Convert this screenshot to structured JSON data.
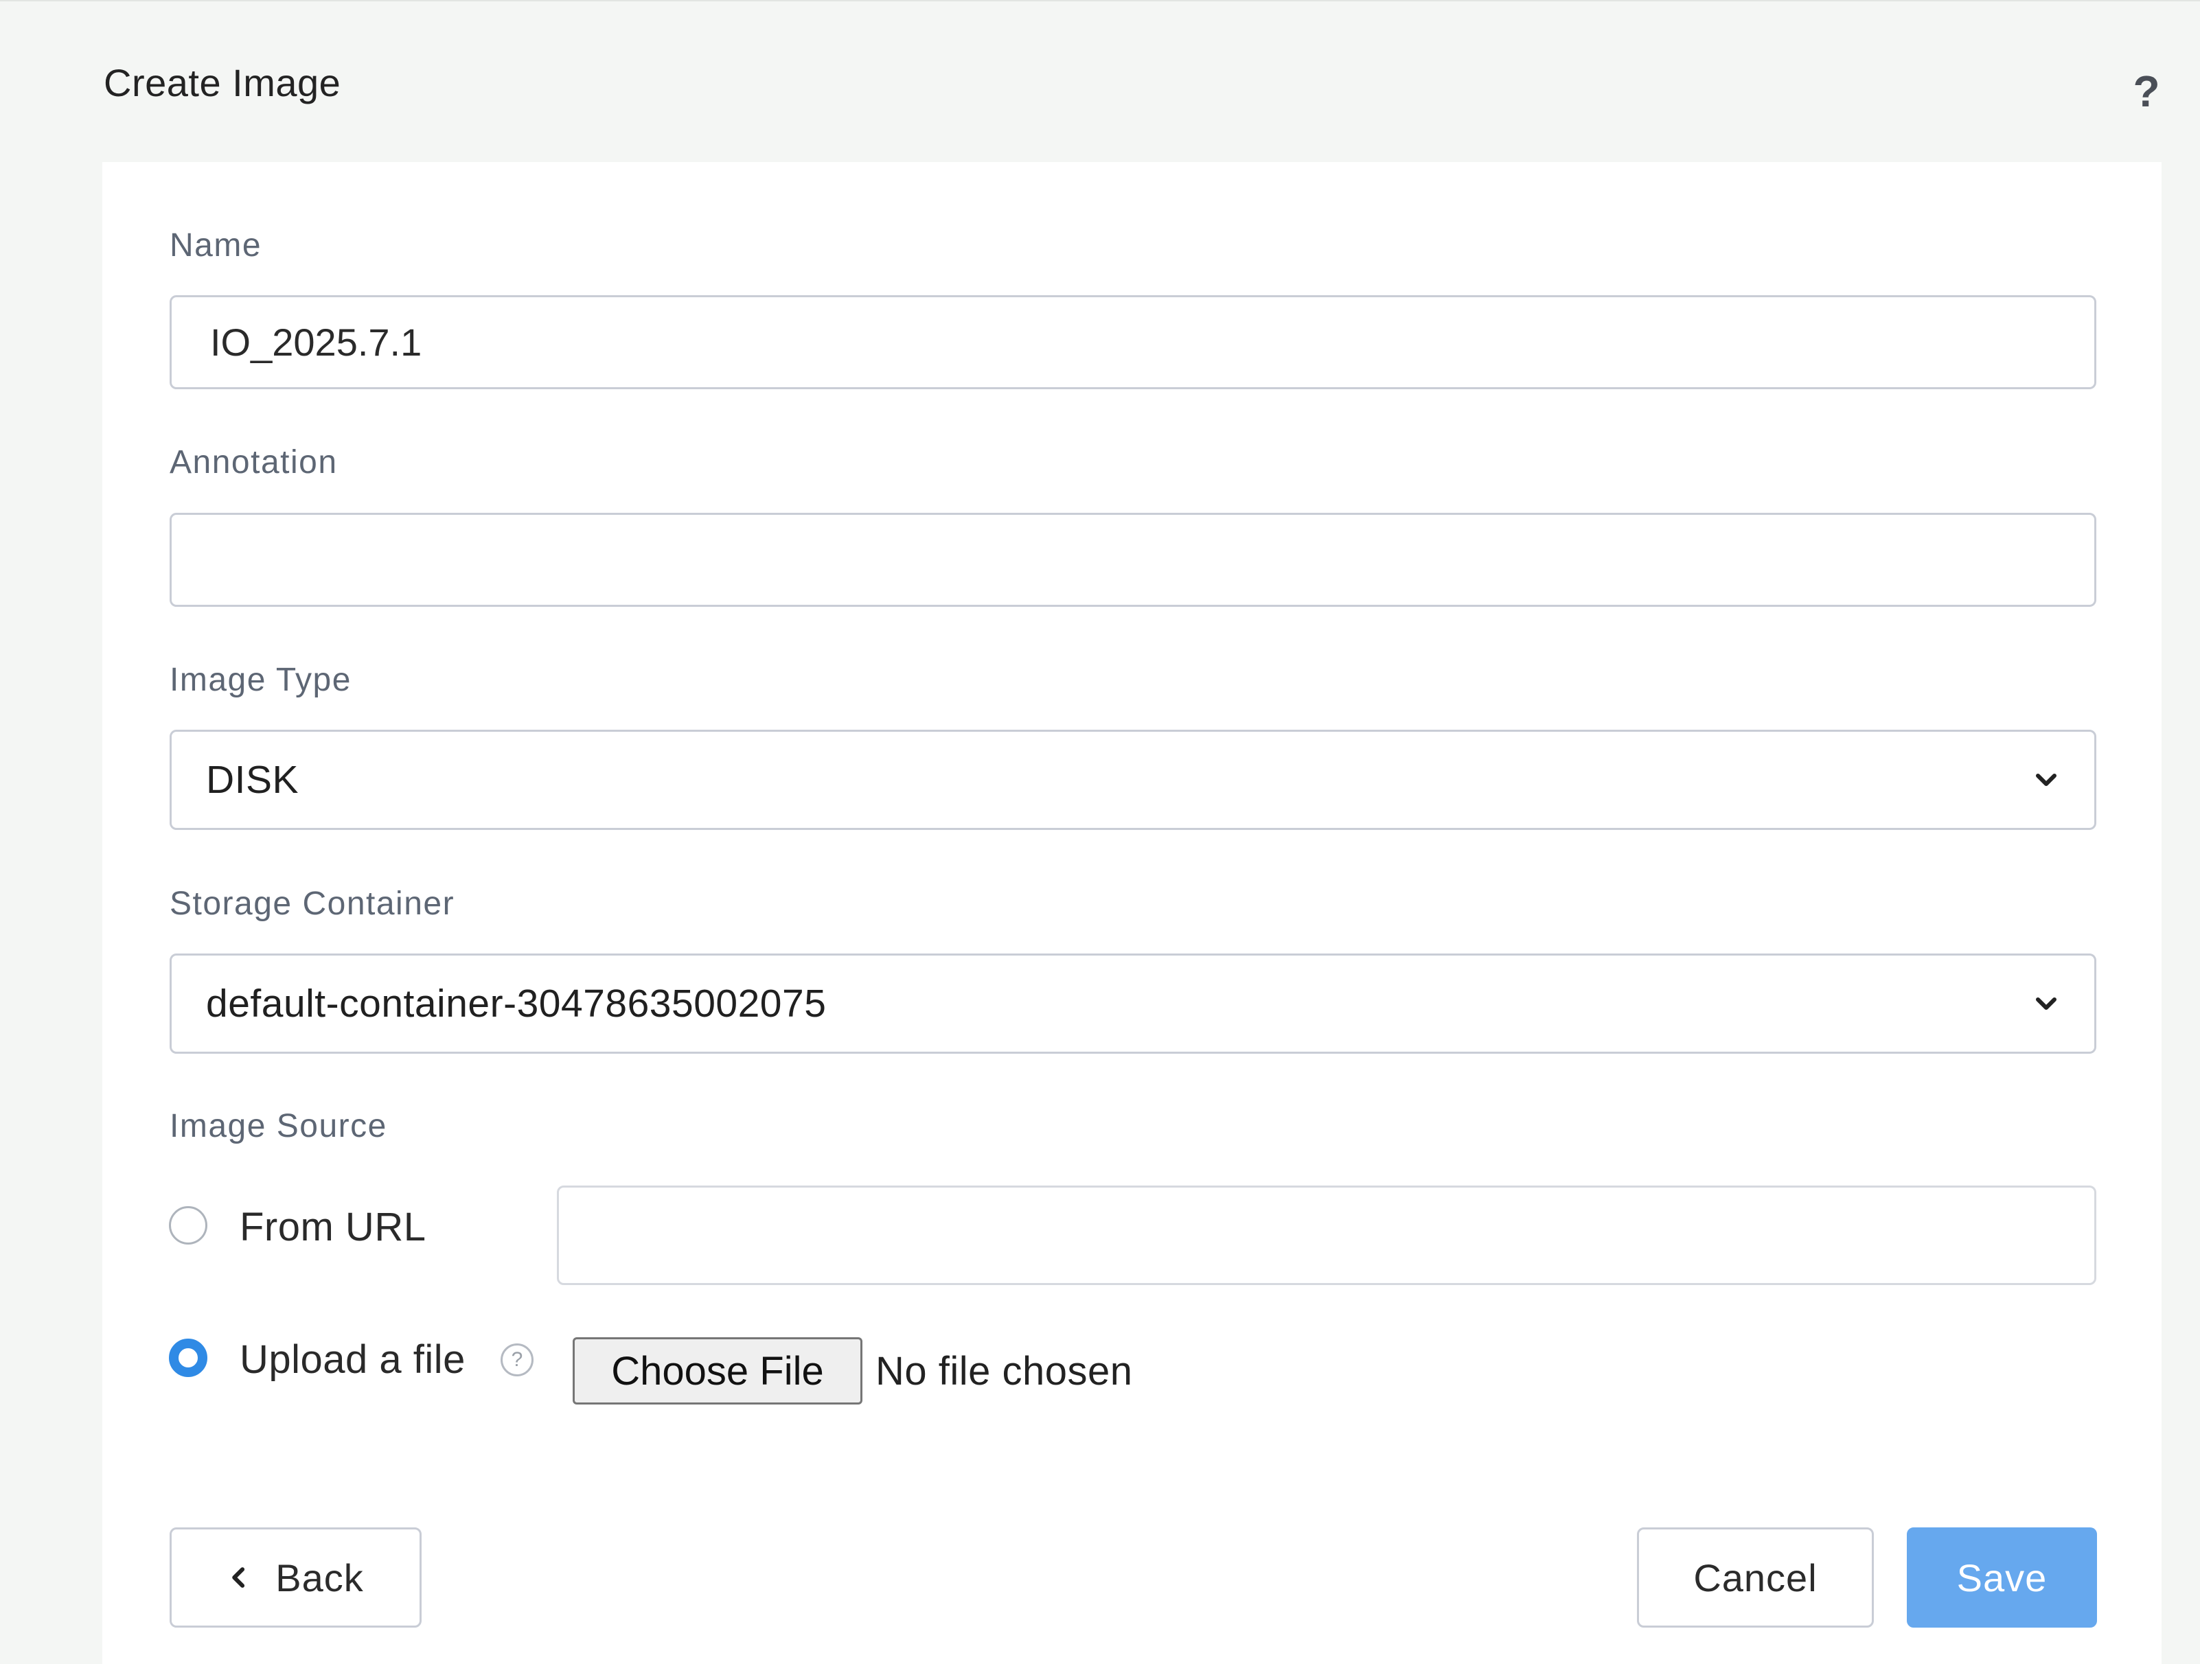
{
  "header": {
    "title": "Create Image",
    "help_label": "?"
  },
  "form": {
    "name": {
      "label": "Name",
      "value": "IO_2025.7.1"
    },
    "annotation": {
      "label": "Annotation",
      "value": ""
    },
    "image_type": {
      "label": "Image Type",
      "selected": "DISK"
    },
    "storage_container": {
      "label": "Storage Container",
      "selected": "default-container-30478635002075"
    },
    "image_source": {
      "label": "Image Source",
      "from_url": {
        "label": "From URL",
        "checked": false,
        "value": ""
      },
      "upload_file": {
        "label": "Upload a file",
        "checked": true,
        "info_glyph": "?",
        "choose_button_label": "Choose File",
        "status_text": "No file chosen"
      }
    }
  },
  "footer": {
    "back_label": "Back",
    "cancel_label": "Cancel",
    "save_label": "Save"
  },
  "colors": {
    "accent": "#2f8ae5",
    "save_button": "#66a8ee",
    "label_text": "#5d6674",
    "border": "#c9cdd6"
  },
  "icons": {
    "help": "help-icon",
    "select_chevron": "chevron-down-icon",
    "info": "info-icon",
    "back": "chevron-left-icon"
  }
}
